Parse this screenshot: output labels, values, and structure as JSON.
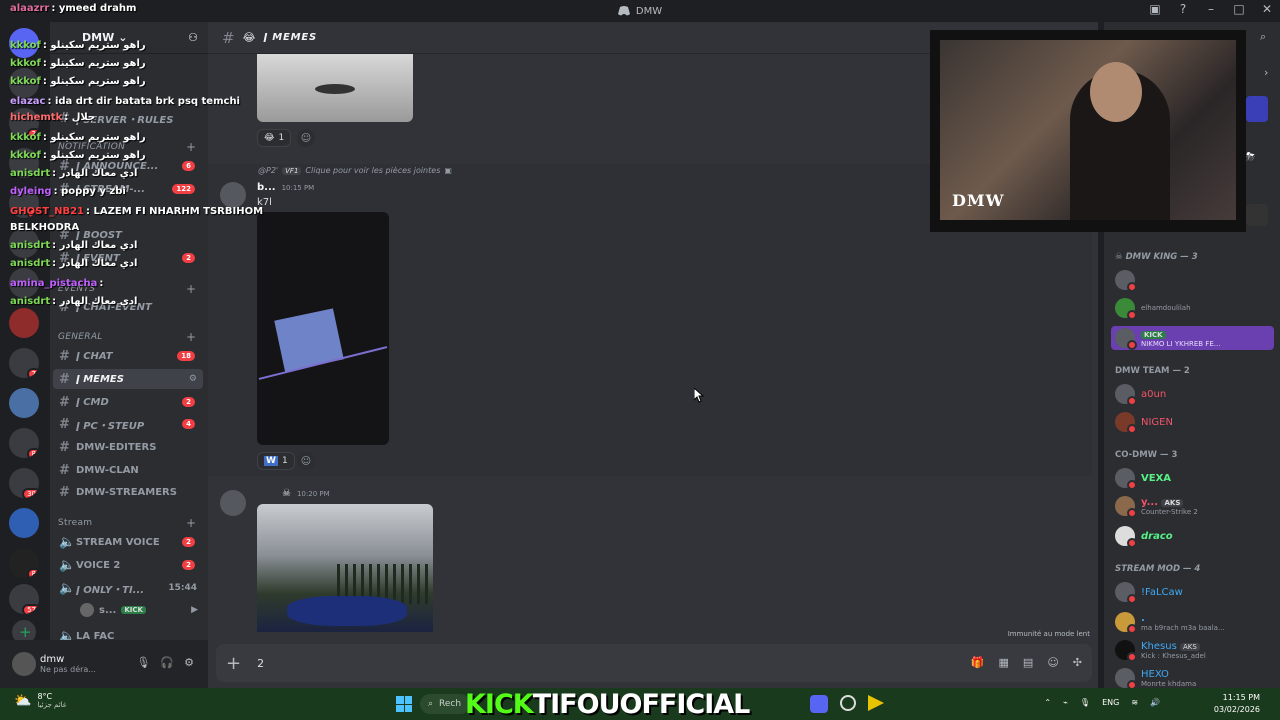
{
  "window": {
    "title": "DMW"
  },
  "server": {
    "name": "DMW"
  },
  "rail_badges": [
    "2",
    "1",
    "7",
    "8",
    "30",
    "8",
    "57",
    "161"
  ],
  "channel_list": {
    "categories": {
      "notification": "NOTIFICATION",
      "events": "EVENTS",
      "general": "GENERAL",
      "stream": "Stream"
    },
    "channels": [
      {
        "name": "ǀ SERVER・RULES",
        "badge": ""
      },
      {
        "name": "ǀ ANNOUNCE...",
        "badge": "6"
      },
      {
        "name": "ǀ STREAM-...",
        "badge": "122"
      },
      {
        "name": "ǀ BOOST",
        "badge": ""
      },
      {
        "name": "ǀ EVENT",
        "badge": "2"
      },
      {
        "name": "ǀ CHAT-EVENT",
        "badge": ""
      },
      {
        "name": "ǀ CHAT",
        "badge": "18"
      },
      {
        "name": "ǀ MEMES",
        "badge": ""
      },
      {
        "name": "ǀ CMD",
        "badge": "2"
      },
      {
        "name": "ǀ PC・STEUP",
        "badge": "4"
      },
      {
        "name": "DMW-EDITERS",
        "badge": ""
      },
      {
        "name": "DMW-CLAN",
        "badge": ""
      },
      {
        "name": "DMW-STREAMERS",
        "badge": ""
      }
    ],
    "voice": [
      {
        "name": "STREAM VOICE",
        "badge": "2"
      },
      {
        "name": "VOICE 2",
        "badge": "2"
      },
      {
        "name": "ǀ ONLY・TI...",
        "time": "15:44"
      },
      {
        "name": "LA FAC",
        "badge": ""
      }
    ],
    "voice_user": {
      "name": "s...",
      "tag": "KICK"
    }
  },
  "user_panel": {
    "name": "dmw",
    "status": "Ne pas déra..."
  },
  "overlay_chat": [
    {
      "user": "alaazrr",
      "msg": ": ymeed drahm",
      "color": "#e06c9f"
    },
    {
      "user": "kkkof",
      "msg": ": راهو ستريم سكينلو",
      "color": "#7ed957"
    },
    {
      "user": "kkkof",
      "msg": ": راهو ستريم سكينلو",
      "color": "#7ed957"
    },
    {
      "user": "kkkof",
      "msg": ": راهو ستريم سكينلو",
      "color": "#7ed957"
    },
    {
      "user": "elazac",
      "msg": ": ida drt dir batata brk psq temchi",
      "color": "#c9a0ff"
    },
    {
      "user": "hichemtk",
      "msg": ": جلال",
      "color": "#ff6b6b"
    },
    {
      "user": "kkkof",
      "msg": ": راهو ستريم سكينلو",
      "color": "#7ed957"
    },
    {
      "user": "kkkof",
      "msg": ": راهو ستريم سكينلو",
      "color": "#7ed957"
    },
    {
      "user": "anisdrt",
      "msg": ": ادي معاك الهادر",
      "color": "#7ed957"
    },
    {
      "user": "dyleing",
      "msg": ": poppy y zbi",
      "color": "#c060ff"
    },
    {
      "user": "GHOST_NB21",
      "msg": ": LAZEM FI NHARHM TSRBIHOM",
      "color": "#ff4040"
    },
    {
      "user": "BELKHODRA",
      "msg": "",
      "color": "#ffffff"
    },
    {
      "user": "anisdrt",
      "msg": ": ادي معاك الهادر",
      "color": "#7ed957"
    },
    {
      "user": "anisdrt",
      "msg": ": ادي معاك الهادر",
      "color": "#7ed957"
    },
    {
      "user": "amina_pistacha",
      "msg": ":",
      "color": "#c060ff"
    },
    {
      "user": "anisdrt",
      "msg": ": ادي معاك الهادر",
      "color": "#7ed957"
    }
  ],
  "channel_header": {
    "name": "ǀ MEMES"
  },
  "messages": {
    "m1_reaction_count": "1",
    "reply_preview": "Clique pour voir les pièces jointes",
    "reply_user": "@P2'",
    "reply_tag": "VF1",
    "m2_user": "b...",
    "m2_time": "10:15 PM",
    "m2_text": "k7l",
    "m2_reaction_emoji": "W",
    "m2_reaction_count": "1",
    "m3_time": "10:20 PM"
  },
  "composer": {
    "value": "2"
  },
  "slow_mode": "Immunité au mode lent",
  "members": {
    "groups": [
      {
        "title": "DMW KING — 3"
      },
      {
        "title": "DMW TEAM — 2"
      },
      {
        "title": "CO-DMW — 3"
      },
      {
        "title": "STREAM MOD — 4"
      }
    ],
    "list": [
      {
        "name": "",
        "status": "",
        "color": "#dbdee1"
      },
      {
        "name": "",
        "status": "elhamdoulilah",
        "color": "#dbdee1"
      },
      {
        "name": "",
        "status": "NIKMO LI YKHREB FE...",
        "tag": "KICK",
        "color": "#dbdee1"
      },
      {
        "name": "a0un",
        "status": "",
        "color": "#f2546a"
      },
      {
        "name": "NIGEN",
        "status": "",
        "color": "#f2546a"
      },
      {
        "name": "VEXA",
        "status": "",
        "color": "#57f287"
      },
      {
        "name": "y...",
        "status": "Counter-Strike 2",
        "tag": "AKS",
        "color": "#f2546a"
      },
      {
        "name": "draco",
        "status": "",
        "color": "#57f287"
      },
      {
        "name": "!FaLCaw",
        "status": "",
        "color": "#3fa9f5"
      },
      {
        "name": ".",
        "status": "ma b9rach m3a baala...",
        "color": "#3fa9f5"
      },
      {
        "name": "Khesus",
        "status": "Kick : Khesus_adel",
        "tag": "AKS",
        "color": "#3fa9f5"
      },
      {
        "name": "HEXO",
        "status": "Monrte khdama",
        "color": "#3fa9f5"
      }
    ]
  },
  "webcam": {
    "logo": "DMW"
  },
  "taskbar": {
    "temp": "8°C",
    "weather": "غائم جزئيا",
    "search": "Rech",
    "kick_brand": "KICK",
    "kick_channel": "TIFOUOFFICIAL",
    "lang": "ENG",
    "time": "11:15 PM",
    "date": "03/02/2026"
  }
}
